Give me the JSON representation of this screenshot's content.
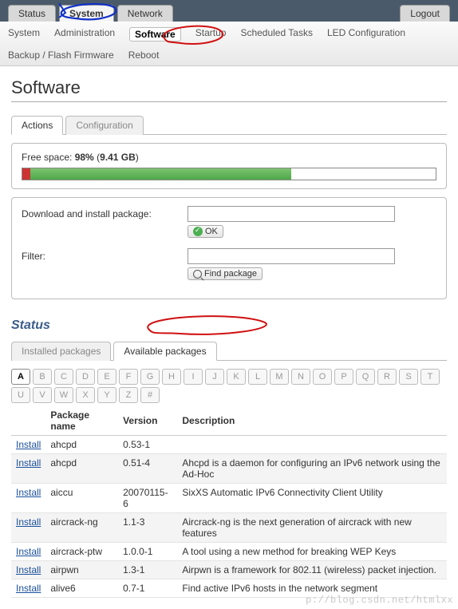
{
  "topTabs": {
    "status": "Status",
    "system": "System",
    "network": "Network",
    "logout": "Logout"
  },
  "subTabs": [
    "System",
    "Administration",
    "Software",
    "Startup",
    "Scheduled Tasks",
    "LED Configuration",
    "Backup / Flash Firmware",
    "Reboot"
  ],
  "subTabActive": 2,
  "pageTitle": "Software",
  "actionTabs": {
    "actions": "Actions",
    "configuration": "Configuration"
  },
  "freespace": {
    "label_prefix": "Free space: ",
    "percent": "98%",
    "size": "9.41 GB"
  },
  "download": {
    "label": "Download and install package:",
    "ok": "OK"
  },
  "filter": {
    "label": "Filter:",
    "find": "Find package"
  },
  "statusHeading": "Status",
  "pkgTabs": {
    "installed": "Installed packages",
    "available": "Available packages"
  },
  "alpha": [
    "A",
    "B",
    "C",
    "D",
    "E",
    "F",
    "G",
    "H",
    "I",
    "J",
    "K",
    "L",
    "M",
    "N",
    "O",
    "P",
    "Q",
    "R",
    "S",
    "T",
    "U",
    "V",
    "W",
    "X",
    "Y",
    "Z",
    "#"
  ],
  "alphaActive": "A",
  "columns": {
    "action": "",
    "name": "Package name",
    "version": "Version",
    "desc": "Description"
  },
  "installLabel": "Install",
  "packages": [
    {
      "name": "ahcpd",
      "version": "0.53-1",
      "desc": ""
    },
    {
      "name": "ahcpd",
      "version": "0.51-4",
      "desc": "Ahcpd is a daemon for configuring an IPv6 network using the Ad-Hoc"
    },
    {
      "name": "aiccu",
      "version": "20070115-6",
      "desc": "SixXS Automatic IPv6 Connectivity Client Utility"
    },
    {
      "name": "aircrack-ng",
      "version": "1.1-3",
      "desc": "Aircrack-ng is the next generation of aircrack with new features"
    },
    {
      "name": "aircrack-ptw",
      "version": "1.0.0-1",
      "desc": "A tool using a new method for breaking WEP Keys"
    },
    {
      "name": "airpwn",
      "version": "1.3-1",
      "desc": "Airpwn is a framework for 802.11 (wireless) packet injection."
    },
    {
      "name": "alive6",
      "version": "0.7-1",
      "desc": "Find active IPv6 hosts in the network segment"
    }
  ],
  "watermark": "p://blog.csdn.net/htmlxx"
}
